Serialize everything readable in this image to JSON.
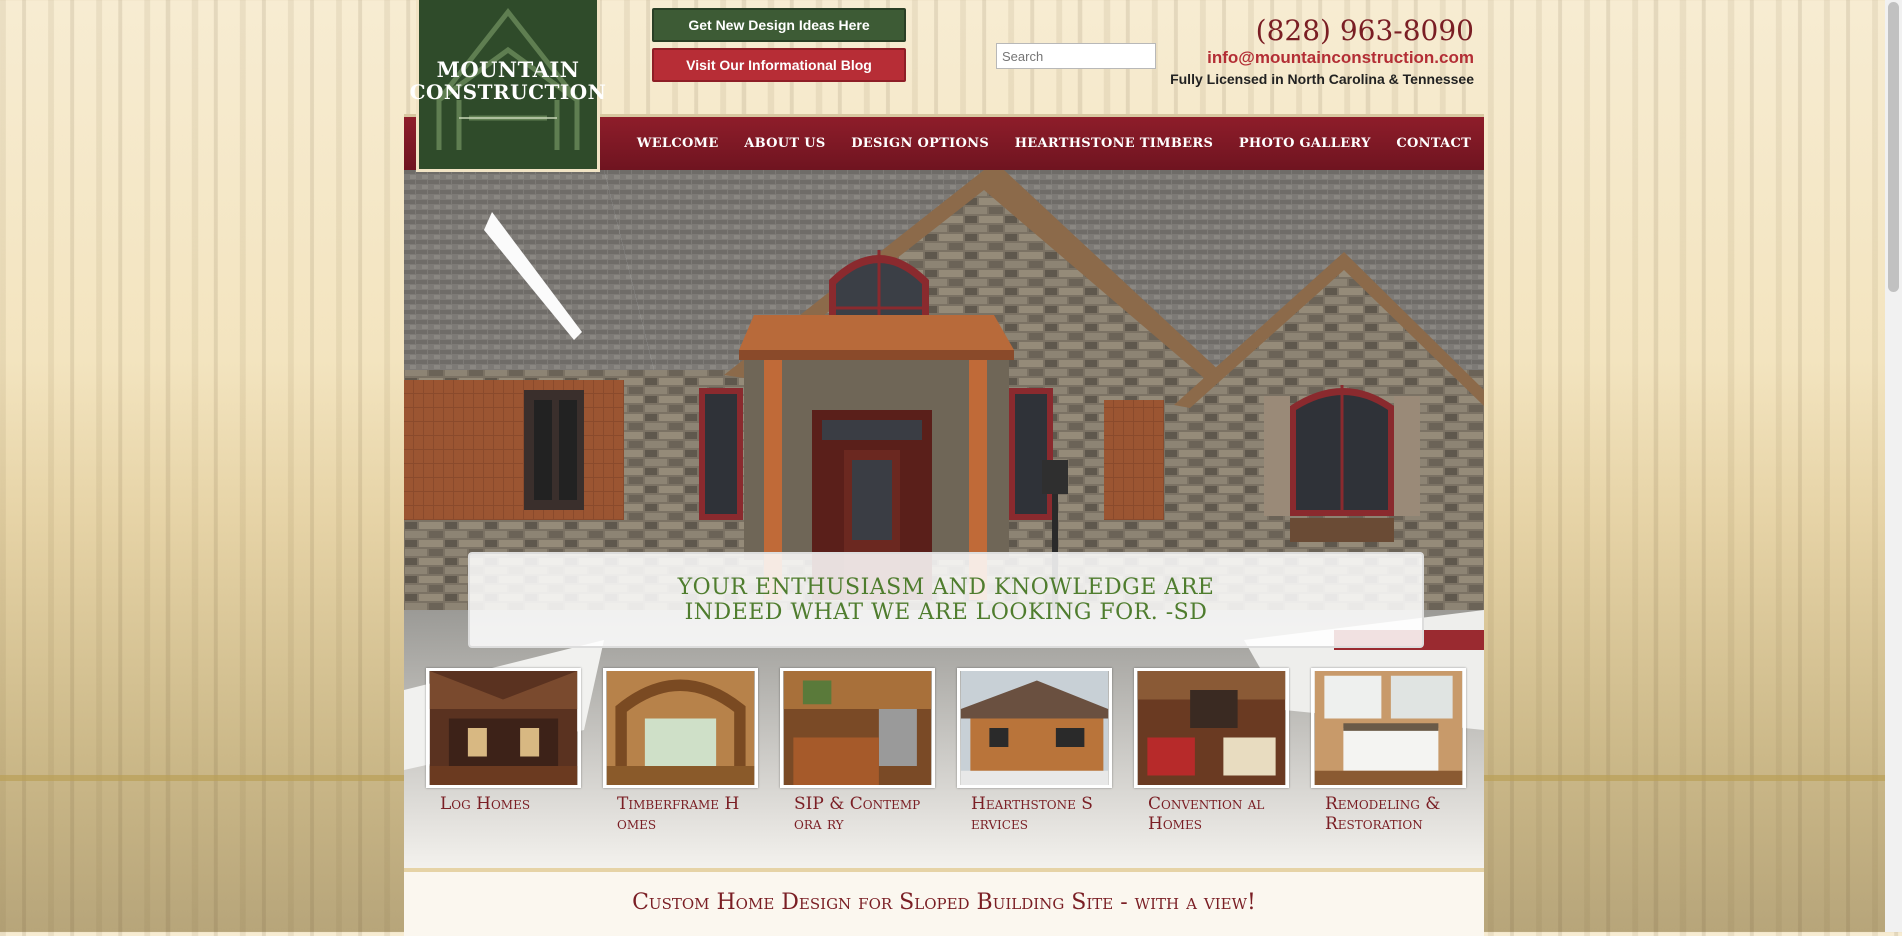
{
  "header": {
    "logo": {
      "line1": "Mountain",
      "line2": "Construction"
    },
    "buttons": {
      "design_ideas": "Get New Design Ideas Here",
      "blog": "Visit Our Informational Blog"
    },
    "search": {
      "placeholder": "Search"
    },
    "contact": {
      "phone": "(828) 963-8090",
      "email": "info@mountainconstruction.com",
      "license": "Fully Licensed in North Carolina & Tennessee"
    }
  },
  "nav": {
    "items": [
      "Welcome",
      "About Us",
      "Design Options",
      "Hearthstone Timbers",
      "Photo Gallery",
      "Contact"
    ]
  },
  "hero": {
    "quote": "Your enthusiasm and knowledge are indeed what we are looking for. -SD"
  },
  "categories": [
    {
      "label": "Log Homes"
    },
    {
      "label": "Timberframe Homes"
    },
    {
      "label": "SIP & Contempora ry"
    },
    {
      "label": "Hearthstone Services"
    },
    {
      "label": "Convention al Homes"
    },
    {
      "label": "Remodeling & Restoration"
    }
  ],
  "tagline": "Custom Home Design for Sloped Building Site - with a view!",
  "colors": {
    "brand_green": "#2f4b2a",
    "brand_maroon": "#7a1e24",
    "button_red": "#b72d36",
    "quote_green": "#4f7d2e"
  }
}
